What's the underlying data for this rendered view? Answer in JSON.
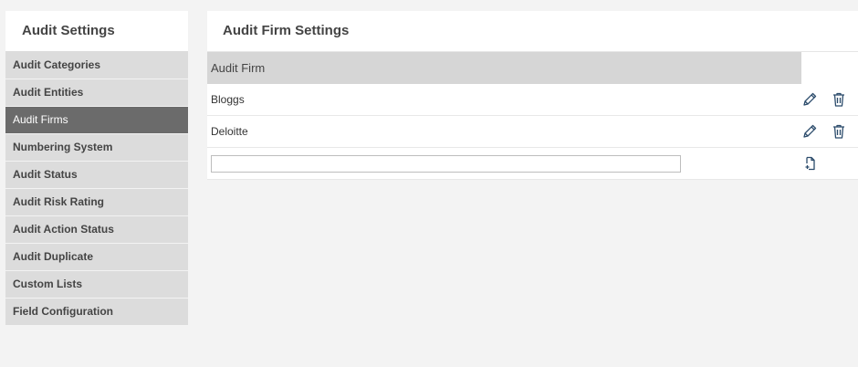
{
  "sidebar": {
    "title": "Audit Settings",
    "items": [
      {
        "label": "Audit Categories"
      },
      {
        "label": "Audit Entities"
      },
      {
        "label": "Audit Firms"
      },
      {
        "label": "Numbering System"
      },
      {
        "label": "Audit Status"
      },
      {
        "label": "Audit Risk Rating"
      },
      {
        "label": "Audit Action Status"
      },
      {
        "label": "Audit Duplicate"
      },
      {
        "label": "Custom Lists"
      },
      {
        "label": "Field Configuration"
      }
    ],
    "active_index": 2
  },
  "main": {
    "title": "Audit Firm Settings",
    "table": {
      "column_header": "Audit Firm",
      "rows": [
        {
          "name": "Bloggs"
        },
        {
          "name": "Deloitte"
        }
      ],
      "new_row": {
        "value": "",
        "placeholder": ""
      }
    }
  },
  "icons": {
    "edit": "pencil-icon",
    "delete": "trash-icon",
    "add": "add-file-icon"
  },
  "colors": {
    "active_item_bg": "#6b6b6b",
    "item_bg": "#dcdcdc",
    "table_header_bg": "#d6d6d6",
    "icon": "#2b4b6b"
  }
}
